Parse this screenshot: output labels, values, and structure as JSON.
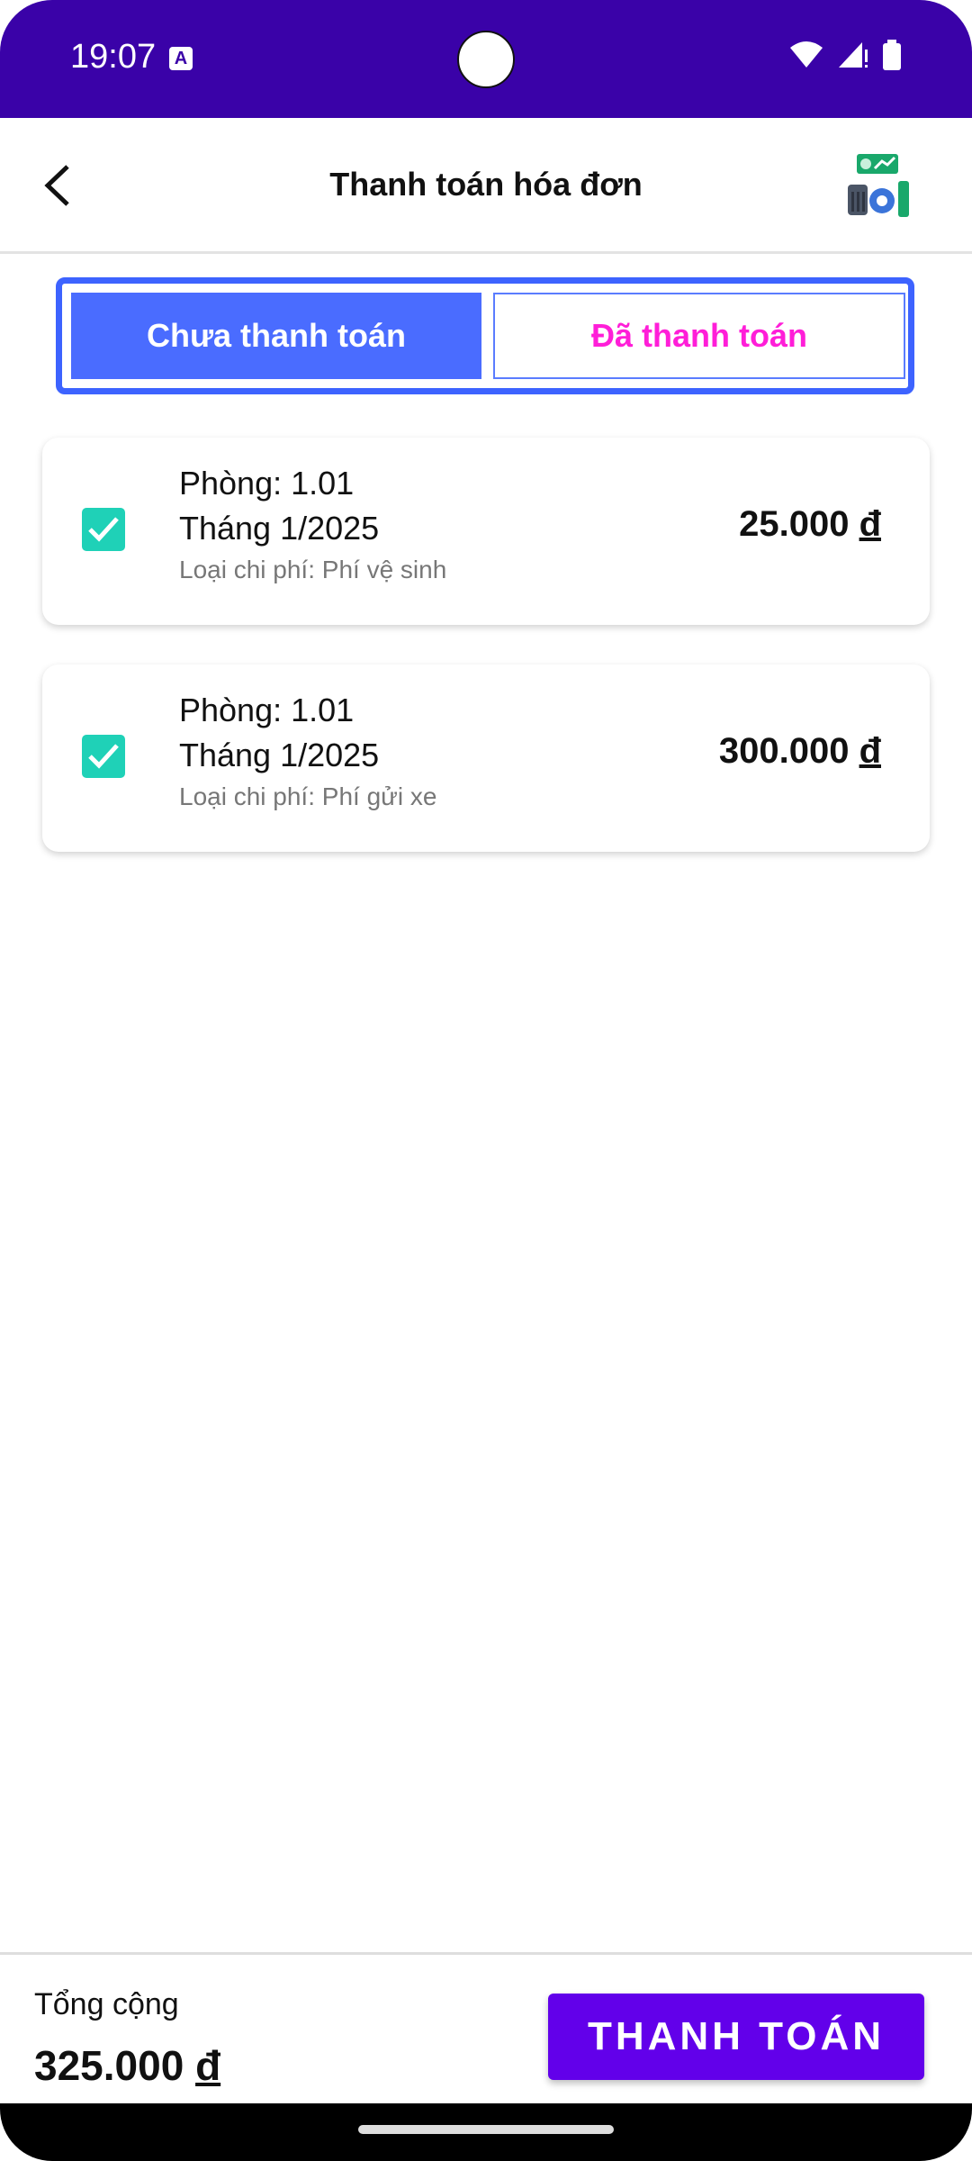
{
  "status": {
    "time": "19:07",
    "keyboard_badge": "A"
  },
  "appbar": {
    "title": "Thanh toán hóa đơn"
  },
  "tabs": [
    {
      "label": "Chưa thanh toán",
      "selected": true
    },
    {
      "label": "Đã thanh toán",
      "selected": false
    }
  ],
  "bills": [
    {
      "room": "Phòng: 1.01",
      "month": "Tháng 1/2025",
      "cost_type": "Loại chi phí: Phí vệ sinh",
      "amount": "25.000",
      "currency": "đ",
      "checked": true
    },
    {
      "room": "Phòng: 1.01",
      "month": "Tháng 1/2025",
      "cost_type": "Loại chi phí: Phí gửi xe",
      "amount": "300.000",
      "currency": "đ",
      "checked": true
    }
  ],
  "footer": {
    "total_label": "Tổng cộng",
    "total_amount": "325.000",
    "currency": "đ",
    "pay_button": "THANH TOÁN"
  },
  "colors": {
    "status_bar": "#3a02a8",
    "tab_active": "#4a6cff",
    "tab_inactive_text": "#ff1ed8",
    "checkbox": "#1fd1b7",
    "pay_button": "#6200ea"
  }
}
